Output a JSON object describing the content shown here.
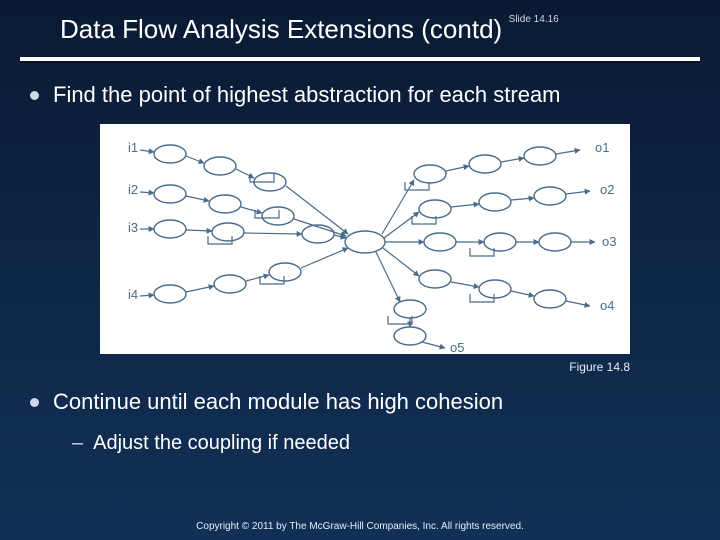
{
  "header": {
    "title": "Data Flow Analysis Extensions (contd)",
    "slide_number": "Slide 14.16"
  },
  "bullets": {
    "b1": "Find the point of highest abstraction for each stream",
    "b2": "Continue until each module has high cohesion",
    "sub1": "Adjust the coupling if needed"
  },
  "figure": {
    "caption": "Figure 14.8",
    "inputs": [
      "i1",
      "i2",
      "i3",
      "i4"
    ],
    "outputs": [
      "o1",
      "o2",
      "o3",
      "o4",
      "o5"
    ]
  },
  "copyright": "Copyright © 2011 by The McGraw-Hill Companies, Inc.  All rights reserved."
}
